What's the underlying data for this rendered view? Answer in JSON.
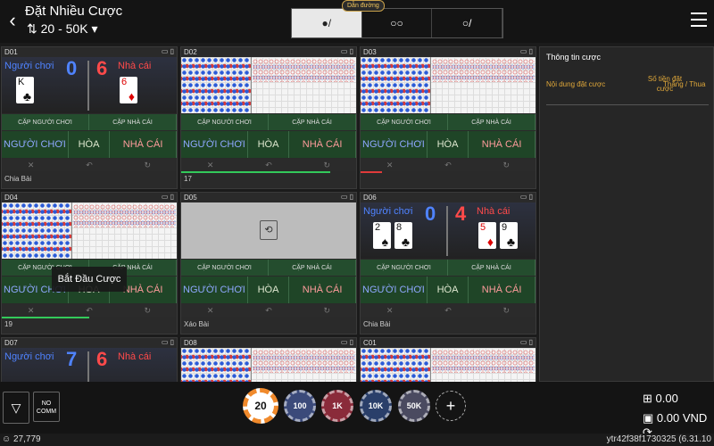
{
  "header": {
    "title": "Đặt Nhiều Cược",
    "limit": "20 - 50K",
    "road_badge": "Dẫn đường",
    "modes": [
      "●/",
      "○○",
      "○/"
    ]
  },
  "tables": [
    {
      "id": "D01",
      "player_label": "Người chơi",
      "banker_label": "Nhà cái",
      "player_score": "0",
      "banker_score": "6",
      "status": "Chia Bài",
      "progress": 0
    },
    {
      "id": "D02",
      "status": "17",
      "progress": 0.85
    },
    {
      "id": "D03",
      "status": "",
      "progress": 0.12
    },
    {
      "id": "D04",
      "status": "19",
      "progress": 0.5
    },
    {
      "id": "D05",
      "status": "Xáo Bài",
      "progress": 0
    },
    {
      "id": "D06",
      "player_label": "Người chơi",
      "banker_label": "Nhà cái",
      "player_score": "0",
      "banker_score": "4",
      "status": "Chia Bài",
      "progress": 0
    },
    {
      "id": "D07",
      "player_label": "Người chơi",
      "banker_label": "Nhà cái",
      "player_score": "7",
      "banker_score": "6"
    },
    {
      "id": "D08"
    },
    {
      "id": "C01"
    }
  ],
  "bet_labels": {
    "pair_player": "CẶP NGƯỜI CHƠI",
    "pair_banker": "CẶP NHÀ CÁI",
    "player": "NGƯỜI CHƠI",
    "tie": "HÒA",
    "banker": "NHÀ CÁI"
  },
  "bet_popup": "Bắt Đầu Cược",
  "bet_info": {
    "title": "Thông tin cược",
    "col1": "Nội dung đặt cược",
    "col2": "Số tiền đặt cược",
    "col3": "Thắng / Thua"
  },
  "chips": [
    "20",
    "100",
    "1K",
    "10K",
    "50K"
  ],
  "chip_colors": [
    "#f08a2c",
    "#3b4a7a",
    "#8a2b3a",
    "#2a3f6a",
    "#4a4a60"
  ],
  "nocomm": "NO COMM",
  "balances": {
    "bet": "0.00",
    "wallet": "0.00 VND"
  },
  "footer": {
    "online": "27,779",
    "version": "ytr42f38f1730325 (6.31.10"
  }
}
